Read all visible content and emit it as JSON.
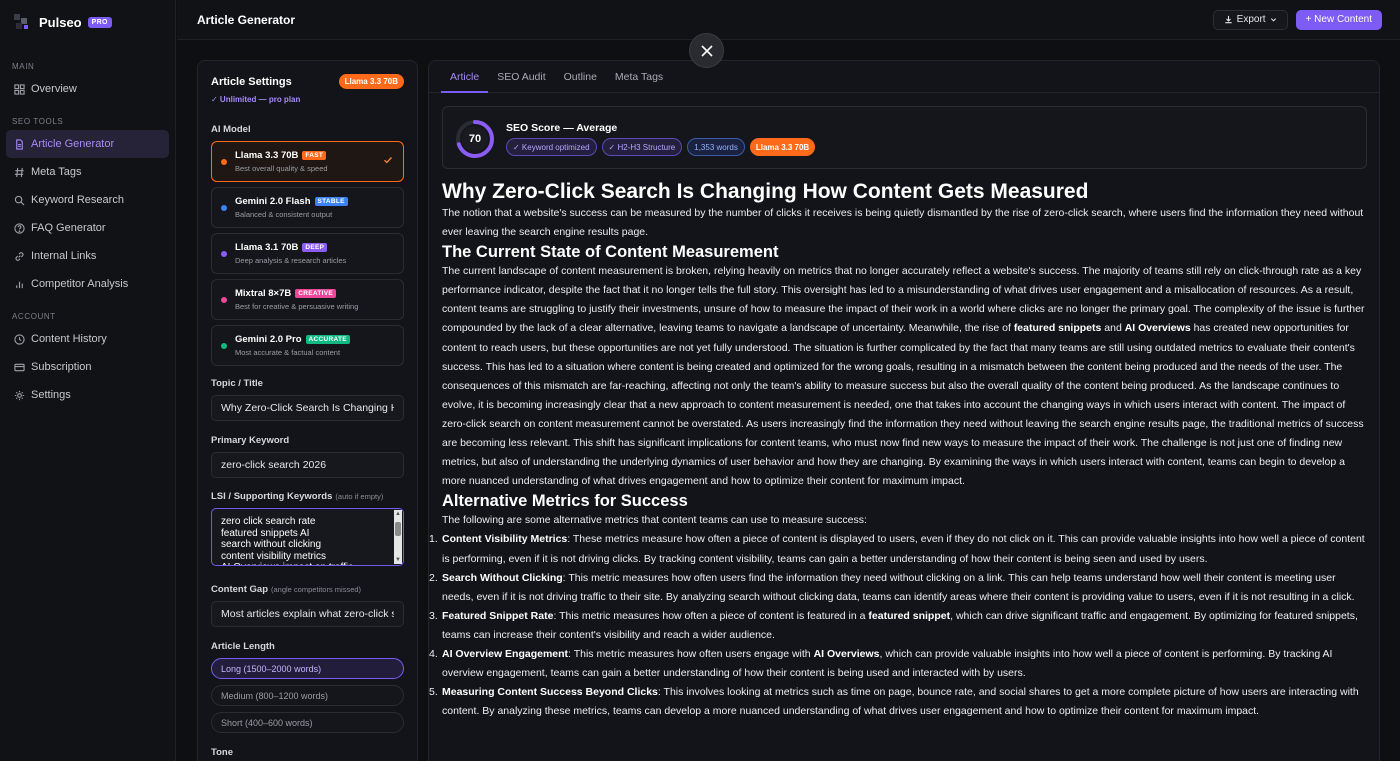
{
  "brand": {
    "name": "Pulseo",
    "badge": "PRO"
  },
  "sidebar": {
    "sections": [
      {
        "label": "MAIN"
      },
      {
        "label": "SEO TOOLS"
      },
      {
        "label": "ACCOUNT"
      }
    ],
    "items": [
      {
        "label": "Overview",
        "icon": "grid-icon"
      },
      {
        "label": "Article Generator",
        "icon": "document-icon",
        "active": true
      },
      {
        "label": "Meta Tags",
        "icon": "hash-icon"
      },
      {
        "label": "Keyword Research",
        "icon": "search-icon"
      },
      {
        "label": "FAQ Generator",
        "icon": "help-circle-icon"
      },
      {
        "label": "Internal Links",
        "icon": "link-icon"
      },
      {
        "label": "Competitor Analysis",
        "icon": "bar-chart-icon"
      },
      {
        "label": "Content History",
        "icon": "history-icon"
      },
      {
        "label": "Subscription",
        "icon": "card-icon"
      },
      {
        "label": "Settings",
        "icon": "gear-icon"
      }
    ]
  },
  "header": {
    "title": "Article Generator",
    "export_label": "Export",
    "new_label": "+ New Content"
  },
  "settings": {
    "title": "Article Settings",
    "model_pill": "Llama 3.3 70B",
    "plan_note": "✓ Unlimited — pro plan",
    "ai_model_label": "AI Model",
    "models": [
      {
        "name": "Llama 3.3 70B",
        "tag": "FAST",
        "desc": "Best overall quality & speed",
        "dot": "#ff6a1a",
        "tag_color": "#ff6a1a",
        "selected": true
      },
      {
        "name": "Gemini 2.0 Flash",
        "tag": "STABLE",
        "desc": "Balanced & consistent output",
        "dot": "#3b82f6",
        "tag_color": "#3b82f6"
      },
      {
        "name": "Llama 3.1 70B",
        "tag": "DEEP",
        "desc": "Deep analysis & research articles",
        "dot": "#8b5cf6",
        "tag_color": "#8b5cf6"
      },
      {
        "name": "Mixtral 8×7B",
        "tag": "CREATIVE",
        "desc": "Best for creative & persuasive writing",
        "dot": "#ec4899",
        "tag_color": "#ec4899"
      },
      {
        "name": "Gemini 2.0 Pro",
        "tag": "ACCURATE",
        "desc": "Most accurate & factual content",
        "dot": "#10b981",
        "tag_color": "#10b981"
      }
    ],
    "topic_label": "Topic / Title",
    "topic_value": "Why Zero-Click Search Is Changing How Content Gets Measured",
    "keyword_label": "Primary Keyword",
    "keyword_value": "zero-click search 2026",
    "lsi_label": "LSI / Supporting Keywords",
    "lsi_hint": "(auto if empty)",
    "lsi_lines": [
      "zero click search rate",
      "featured snippets AI",
      "search without clicking",
      "content visibility metrics",
      "AI Overviews impact on traffic"
    ],
    "gap_label": "Content Gap",
    "gap_hint": "(angle competitors missed)",
    "gap_value": "Most articles explain what zero-click search is",
    "length_label": "Article Length",
    "lengths": [
      {
        "label": "Long (1500–2000 words)",
        "active": true
      },
      {
        "label": "Medium (800–1200 words)"
      },
      {
        "label": "Short (400–600 words)"
      }
    ],
    "tone_label": "Tone"
  },
  "tabs": [
    {
      "label": "Article",
      "active": true
    },
    {
      "label": "SEO Audit"
    },
    {
      "label": "Outline"
    },
    {
      "label": "Meta Tags"
    }
  ],
  "seo": {
    "score": 70,
    "score_fraction": 0.7,
    "title": "SEO Score — Average",
    "tags": [
      {
        "label": "✓ Keyword optimized",
        "style": "purple"
      },
      {
        "label": "✓ H2-H3 Structure",
        "style": "purple"
      },
      {
        "label": "1,353 words",
        "style": "blue"
      },
      {
        "label": "Llama 3.3 70B",
        "style": "orange"
      }
    ]
  },
  "article": {
    "h1": "Why Zero-Click Search Is Changing How Content Gets Measured",
    "intro": "The notion that a website's success can be measured by the number of clicks it receives is being quietly dismantled by the rise of zero-click search, where users find the information they need without ever leaving the search engine results page.",
    "h2_1": "The Current State of Content Measurement",
    "p1_a": "The current landscape of content measurement is broken, relying heavily on metrics that no longer accurately reflect a website's success. The majority of teams still rely on click-through rate as a key performance indicator, despite the fact that it no longer tells the full story. This oversight has led to a misunderstanding of what drives user engagement and a misallocation of resources. As a result, content teams are struggling to justify their investments, unsure of how to measure the impact of their work in a world where clicks are no longer the primary goal. The complexity of the issue is further compounded by the lack of a clear alternative, leaving teams to navigate a landscape of uncertainty. Meanwhile, the rise of ",
    "p1_b1": "featured snippets",
    "p1_and": " and ",
    "p1_b2": "AI Overviews",
    "p1_c": " has created new opportunities for content to reach users, but these opportunities are not yet fully understood. The situation is further complicated by the fact that many teams are still using outdated metrics to evaluate their content's success. This has led to a situation where content is being created and optimized for the wrong goals, resulting in a mismatch between the content being produced and the needs of the user. The consequences of this mismatch are far-reaching, affecting not only the team's ability to measure success but also the overall quality of the content being produced. As the landscape continues to evolve, it is becoming increasingly clear that a new approach to content measurement is needed, one that takes into account the changing ways in which users interact with content. The impact of zero-click search on content measurement cannot be overstated. As users increasingly find the information they need without leaving the search engine results page, the traditional metrics of success are becoming less relevant. This shift has significant implications for content teams, who must now find new ways to measure the impact of their work. The challenge is not just one of finding new metrics, but also of understanding the underlying dynamics of user behavior and how they are changing. By examining the ways in which users interact with content, teams can begin to develop a more nuanced understanding of what drives engagement and how to optimize their content for maximum impact.",
    "h2_2": "Alternative Metrics for Success",
    "p2": "The following are some alternative metrics that content teams can use to measure success:",
    "list": [
      {
        "num": "1.",
        "lead": "Content Visibility Metrics",
        "text": ": These metrics measure how often a piece of content is displayed to users, even if they do not click on it. This can provide valuable insights into how well a piece of content is performing, even if it is not driving clicks. By tracking content visibility, teams can gain a better understanding of how their content is being seen and used by users."
      },
      {
        "num": "2.",
        "lead": "Search Without Clicking",
        "text": ": This metric measures how often users find the information they need without clicking on a link. This can help teams understand how well their content is meeting user needs, even if it is not driving traffic to their site. By analyzing search without clicking data, teams can identify areas where their content is providing value to users, even if it is not resulting in a click."
      },
      {
        "num": "3.",
        "lead": "Featured Snippet Rate",
        "text_a": ": This metric measures how often a piece of content is featured in a ",
        "bold_mid": "featured snippet",
        "text": ", which can drive significant traffic and engagement. By optimizing for featured snippets, teams can increase their content's visibility and reach a wider audience."
      },
      {
        "num": "4.",
        "lead": "AI Overview Engagement",
        "text_a": ": This metric measures how often users engage with ",
        "bold_mid": "AI Overviews",
        "text": ", which can provide valuable insights into how well a piece of content is performing. By tracking AI overview engagement, teams can gain a better understanding of how their content is being used and interacted with by users."
      },
      {
        "num": "5.",
        "lead": "Measuring Content Success Beyond Clicks",
        "text": ": This involves looking at metrics such as time on page, bounce rate, and social shares to get a more complete picture of how users are interacting with content. By analyzing these metrics, teams can develop a more nuanced understanding of what drives user engagement and how to optimize their content for maximum impact."
      }
    ]
  },
  "colors": {
    "accent": "#7c5cf5",
    "orange": "#ff6a1a"
  }
}
